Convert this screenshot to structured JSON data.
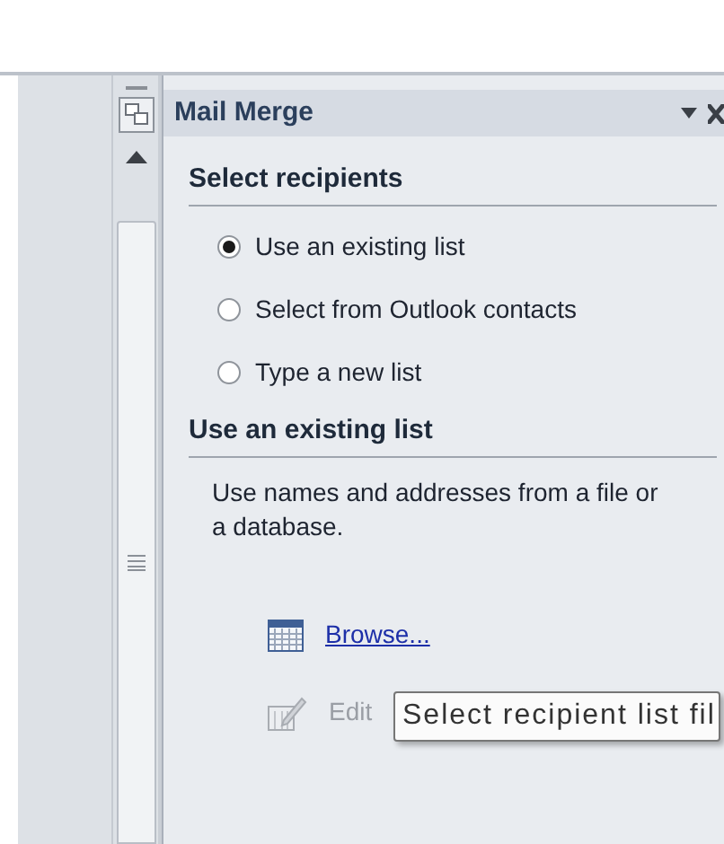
{
  "task_pane": {
    "title": "Mail Merge",
    "sections": [
      {
        "heading": "Select recipients",
        "options": [
          {
            "label": "Use an existing list",
            "selected": true
          },
          {
            "label": "Select from Outlook contacts",
            "selected": false
          },
          {
            "label": "Type a new list",
            "selected": false
          }
        ]
      },
      {
        "heading": "Use an existing list",
        "description": "Use names and addresses from a file or a database.",
        "links": [
          {
            "kind": "browse",
            "label": "Browse...",
            "disabled": false
          },
          {
            "kind": "edit",
            "label": "Edit",
            "disabled": true
          }
        ]
      }
    ],
    "tooltip": "Select recipient list fil"
  }
}
